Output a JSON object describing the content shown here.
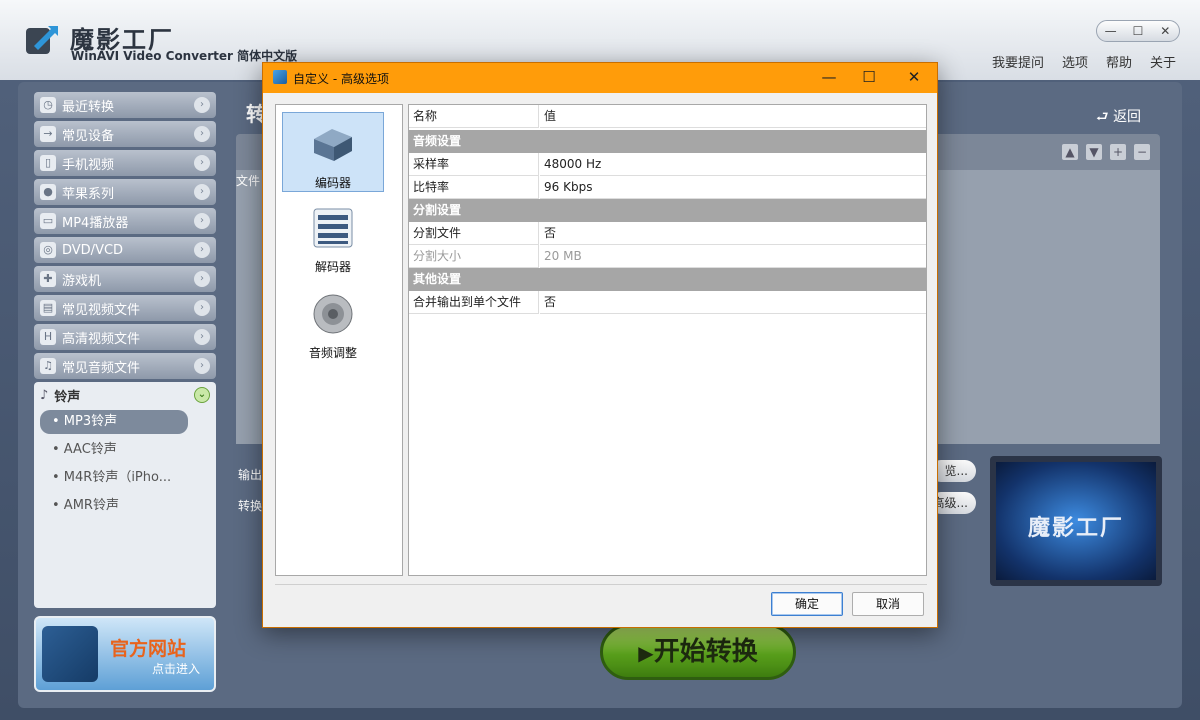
{
  "app": {
    "title": "魔影工厂",
    "subtitle": "WinAVI Video Converter 简体中文版",
    "menu": [
      "我要提问",
      "选项",
      "帮助",
      "关于"
    ],
    "window_controls": [
      "—",
      "☐",
      "✕"
    ]
  },
  "sidebar": {
    "items": [
      {
        "label": "最近转换",
        "icon": "clock-icon"
      },
      {
        "label": "常见设备",
        "icon": "device-icon"
      },
      {
        "label": "手机视频",
        "icon": "phone-icon"
      },
      {
        "label": "苹果系列",
        "icon": "apple-icon"
      },
      {
        "label": "MP4播放器",
        "icon": "mp4-player-icon"
      },
      {
        "label": "DVD/VCD",
        "icon": "disc-icon"
      },
      {
        "label": "游戏机",
        "icon": "gamepad-icon"
      },
      {
        "label": "常见视频文件",
        "icon": "film-icon"
      },
      {
        "label": "高清视频文件",
        "icon": "hd-icon"
      },
      {
        "label": "常见音频文件",
        "icon": "music-icon"
      }
    ],
    "expanded": {
      "label": "铃声",
      "subitems": [
        "• MP3铃声",
        "• AAC铃声",
        "• M4R铃声（iPho...",
        "• AMR铃声"
      ],
      "selected_index": 0
    },
    "banner": {
      "title": "官方网站",
      "subtitle": "点击进入"
    }
  },
  "main": {
    "title_partial": "转",
    "back_label": "返回",
    "list_header": "文件",
    "output_label": "输出",
    "convert_label": "转换",
    "browse_btn": "览...",
    "advanced_btn": "高级...",
    "preview_text": "魔影工厂",
    "start_button": "开始转换"
  },
  "dialog": {
    "title": "自定义 - 高级选项",
    "controls": [
      "—",
      "☐",
      "✕"
    ],
    "nav": [
      {
        "label": "编码器",
        "icon": "encoder-icon",
        "selected": true
      },
      {
        "label": "解码器",
        "icon": "decoder-icon",
        "selected": false
      },
      {
        "label": "音频调整",
        "icon": "speaker-icon",
        "selected": false
      }
    ],
    "grid_header": {
      "name": "名称",
      "value": "值"
    },
    "sections": [
      {
        "title": "音频设置",
        "rows": [
          {
            "name": "采样率",
            "value": "48000 Hz"
          },
          {
            "name": "比特率",
            "value": "96 Kbps"
          }
        ]
      },
      {
        "title": "分割设置",
        "rows": [
          {
            "name": "分割文件",
            "value": "否"
          },
          {
            "name": "分割大小",
            "value": "20 MB",
            "disabled": true
          }
        ]
      },
      {
        "title": "其他设置",
        "rows": [
          {
            "name": "合并输出到单个文件",
            "value": "否"
          }
        ]
      }
    ],
    "ok_label": "确定",
    "cancel_label": "取消"
  },
  "colors": {
    "dialog_titlebar": "#ff9c0a",
    "section_header": "#a6a6a6",
    "start_button": "#5aa11c"
  }
}
